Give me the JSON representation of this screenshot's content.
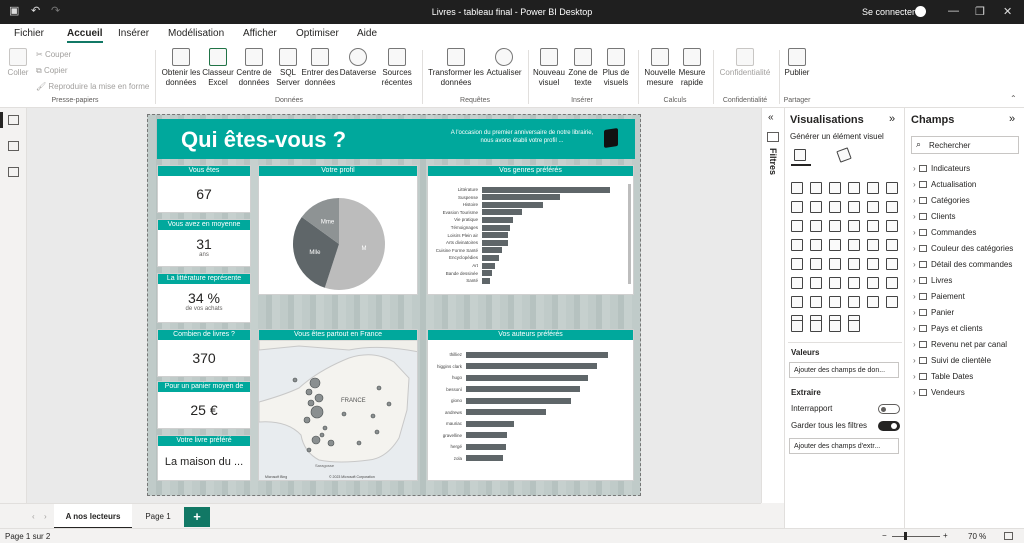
{
  "window": {
    "title": "Livres - tableau final - Power BI Desktop",
    "signin": "Se connecter"
  },
  "tabs": [
    {
      "label": "Fichier"
    },
    {
      "label": "Accueil"
    },
    {
      "label": "Insérer"
    },
    {
      "label": "Modélisation"
    },
    {
      "label": "Afficher"
    },
    {
      "label": "Optimiser"
    },
    {
      "label": "Aide"
    }
  ],
  "ribbon": {
    "clipboard": {
      "paste": "Coller",
      "cut": "Couper",
      "copy": "Copier",
      "format_painter": "Reproduire la mise en forme",
      "group": "Presse-papiers"
    },
    "data": {
      "get_data": "Obtenir les données",
      "excel": "Classeur Excel",
      "datahub": "Centre de données",
      "sql": "SQL Server",
      "enter_data": "Entrer des données",
      "dataverse": "Dataverse",
      "recent": "Sources récentes",
      "group": "Données"
    },
    "queries": {
      "transform": "Transformer les données",
      "refresh": "Actualiser",
      "group": "Requêtes"
    },
    "insert": {
      "new_visual": "Nouveau visuel",
      "textbox": "Zone de texte",
      "more_visuals": "Plus de visuels",
      "group": "Insérer"
    },
    "calc": {
      "new_measure": "Nouvelle mesure",
      "quick_measure": "Mesure rapide",
      "group": "Calculs"
    },
    "sensitivity": {
      "label": "Confidentialité",
      "group": "Confidentialité"
    },
    "share": {
      "publish": "Publier",
      "group": "Partager"
    }
  },
  "report": {
    "title": "Qui êtes-vous ?",
    "subtitle": "A l'occasion du premier anniversaire de notre librairie, nous avons établi votre profil ...",
    "kpis": [
      {
        "title": "Vous êtes",
        "value": "67",
        "unit": ""
      },
      {
        "title": "Vous avez en moyenne",
        "value": "31",
        "unit": "ans"
      },
      {
        "title": "La littérature représente",
        "value": "34 %",
        "unit": "de vos achats"
      },
      {
        "title": "Combien de livres ?",
        "value": "370",
        "unit": ""
      },
      {
        "title": "Pour un panier moyen de",
        "value": "25 €",
        "unit": ""
      },
      {
        "title": "Votre livre préféré",
        "value": "La maison du ...",
        "unit": ""
      }
    ],
    "profile": {
      "title": "Votre profil",
      "slices": [
        {
          "label": "M",
          "value": 0.55,
          "color": "#bcbcbc"
        },
        {
          "label": "Mlle",
          "value": 0.3,
          "color": "#5f6669"
        },
        {
          "label": "Mme",
          "value": 0.15,
          "color": "#8e9394"
        }
      ]
    },
    "genres": {
      "title": "Vos genres préférés",
      "items": [
        {
          "label": "Littérature",
          "value": 100
        },
        {
          "label": "Suspense",
          "value": 61
        },
        {
          "label": "Histoire",
          "value": 48
        },
        {
          "label": "Evasion Tourisme",
          "value": 31
        },
        {
          "label": "Vie pratique",
          "value": 24
        },
        {
          "label": "Témoignages",
          "value": 22
        },
        {
          "label": "Loisirs Plein air",
          "value": 20
        },
        {
          "label": "Arts divinatoires",
          "value": 20
        },
        {
          "label": "Cuisine Forme Santé",
          "value": 16
        },
        {
          "label": "Encyclopédies",
          "value": 13
        },
        {
          "label": "Art",
          "value": 10
        },
        {
          "label": "Bande dessinée",
          "value": 8
        },
        {
          "label": "Santé",
          "value": 6
        }
      ]
    },
    "map": {
      "title": "Vous êtes partout en France",
      "country": "FRANCE",
      "city": "Saragosse",
      "credit": "© 2023 Microsoft Corporation",
      "brand": "Microsoft Bing"
    },
    "authors": {
      "title": "Vos auteurs préférés",
      "items": [
        {
          "label": "thilliez",
          "value": 100
        },
        {
          "label": "higgins clark",
          "value": 92
        },
        {
          "label": "hugo",
          "value": 86
        },
        {
          "label": "bessonì",
          "value": 80
        },
        {
          "label": "giono",
          "value": 74
        },
        {
          "label": "andrews",
          "value": 56
        },
        {
          "label": "mauriac",
          "value": 34
        },
        {
          "label": "gravelline",
          "value": 29
        },
        {
          "label": "hergé",
          "value": 28
        },
        {
          "label": "zola",
          "value": 26
        }
      ]
    }
  },
  "filters": {
    "label": "Filtres"
  },
  "viz": {
    "title": "Visualisations",
    "build_label": "Générer un élément visuel",
    "values_label": "Valeurs",
    "values_placeholder": "Ajouter des champs de don...",
    "drill_label": "Extraire",
    "cross_report": "Interrapport",
    "keep_filters": "Garder tous les filtres",
    "drill_placeholder": "Ajouter des champs d'extr..."
  },
  "fields": {
    "title": "Champs",
    "search_placeholder": "Rechercher",
    "tables": [
      "Indicateurs",
      "Actualisation",
      "Catégories",
      "Clients",
      "Commandes",
      "Couleur des catégories",
      "Détail des commandes",
      "Livres",
      "Paiement",
      "Panier",
      "Pays et clients",
      "Revenu net par canal",
      "Suivi de clientèle",
      "Table Dates",
      "Vendeurs"
    ]
  },
  "pages": {
    "tabs": [
      "A nos lecteurs",
      "Page 1"
    ],
    "add": "+"
  },
  "status": {
    "page": "Page 1 sur 2",
    "zoom": "70 %"
  }
}
